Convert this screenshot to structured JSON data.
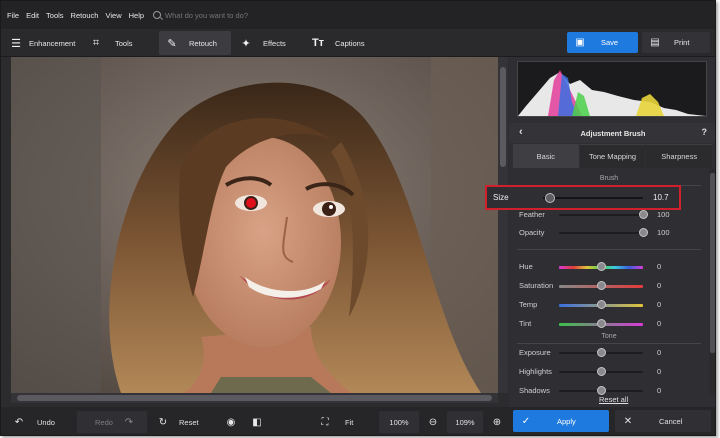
{
  "menubar": {
    "items": [
      "File",
      "Edit",
      "Tools",
      "Retouch",
      "View",
      "Help"
    ],
    "search_placeholder": "What do you want to do?"
  },
  "toolbar": {
    "tabs": [
      {
        "label": "Enhancement",
        "icon": "sliders-icon"
      },
      {
        "label": "Tools",
        "icon": "crop-icon"
      },
      {
        "label": "Retouch",
        "icon": "brush-icon",
        "active": true
      },
      {
        "label": "Effects",
        "icon": "magic-wand-icon"
      },
      {
        "label": "Captions",
        "icon": "text-icon"
      }
    ],
    "save_label": "Save",
    "print_label": "Print"
  },
  "panel": {
    "title": "Adjustment Brush",
    "subtabs": [
      "Basic",
      "Tone Mapping",
      "Sharpness"
    ],
    "active_subtab": "Basic",
    "brush_section": "Brush",
    "size": {
      "label": "Size",
      "value": "10.7",
      "fraction": 0.07
    },
    "brush_rows": [
      {
        "label": "Feather",
        "value": "100",
        "fraction": 1.0
      },
      {
        "label": "Opacity",
        "value": "100",
        "fraction": 1.0
      }
    ],
    "color_rows": [
      {
        "label": "Hue",
        "value": "0",
        "fraction": 0.5,
        "gradient": "linear-gradient(90deg,#d83ad8,#e03b3b,#e0c43b,#4ad04a,#3bc8e0,#3b5ee0,#d83ad8)"
      },
      {
        "label": "Saturation",
        "value": "0",
        "fraction": 0.5,
        "gradient": "linear-gradient(90deg,#888888,#e03b3b)"
      },
      {
        "label": "Temp",
        "value": "0",
        "fraction": 0.5,
        "gradient": "linear-gradient(90deg,#3b6fe0,#e0c43b)"
      },
      {
        "label": "Tint",
        "value": "0",
        "fraction": 0.5,
        "gradient": "linear-gradient(90deg,#3bbf4a,#d83ad8)"
      }
    ],
    "tone_section": "Tone",
    "tone_rows": [
      {
        "label": "Exposure",
        "value": "0",
        "fraction": 0.5
      },
      {
        "label": "Highlights",
        "value": "0",
        "fraction": 0.5
      },
      {
        "label": "Shadows",
        "value": "0",
        "fraction": 0.5
      }
    ],
    "reset_all": "Reset all"
  },
  "bottombar": {
    "undo": "Undo",
    "redo": "Redo",
    "reset": "Reset",
    "fit": "Fit",
    "zoom_actual": "100%",
    "zoom_current": "109%",
    "apply": "Apply",
    "cancel": "Cancel"
  },
  "colors": {
    "accent": "#1f7ae0",
    "highlight_border": "#d0202c",
    "red_eye": "#e0101a"
  }
}
